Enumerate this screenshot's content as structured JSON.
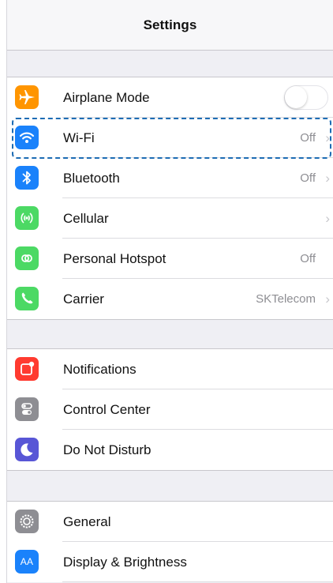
{
  "nav": {
    "title": "Settings"
  },
  "connectivity": [
    {
      "label": "Airplane Mode",
      "icon": "airplane-icon",
      "color": "#ff9500",
      "accessory": "toggle",
      "toggle_on": false
    },
    {
      "label": "Wi-Fi",
      "icon": "wifi-icon",
      "color": "#1a82fb",
      "value": "Off",
      "accessory": "chevron"
    },
    {
      "label": "Bluetooth",
      "icon": "bluetooth-icon",
      "color": "#1a82fb",
      "value": "Off",
      "accessory": "chevron"
    },
    {
      "label": "Cellular",
      "icon": "cellular-icon",
      "color": "#4cd964",
      "accessory": "chevron"
    },
    {
      "label": "Personal Hotspot",
      "icon": "hotspot-icon",
      "color": "#4cd964",
      "value": "Off",
      "accessory": "none"
    },
    {
      "label": "Carrier",
      "icon": "phone-icon",
      "color": "#4cd964",
      "value": "SKTelecom",
      "accessory": "chevron"
    }
  ],
  "system": [
    {
      "label": "Notifications",
      "icon": "notifications-icon",
      "color": "#ff3b30",
      "accessory": "none"
    },
    {
      "label": "Control Center",
      "icon": "control-center-icon",
      "color": "#8e8e93",
      "accessory": "none"
    },
    {
      "label": "Do Not Disturb",
      "icon": "moon-icon",
      "color": "#5856d6",
      "accessory": "none"
    }
  ],
  "general": [
    {
      "label": "General",
      "icon": "gear-icon",
      "color": "#8e8e93",
      "accessory": "none"
    },
    {
      "label": "Display & Brightness",
      "icon": "display-brightness-icon",
      "color": "#1a82fb",
      "icon_text": "AA",
      "accessory": "none"
    }
  ],
  "highlight_color": "#1d6cb4"
}
